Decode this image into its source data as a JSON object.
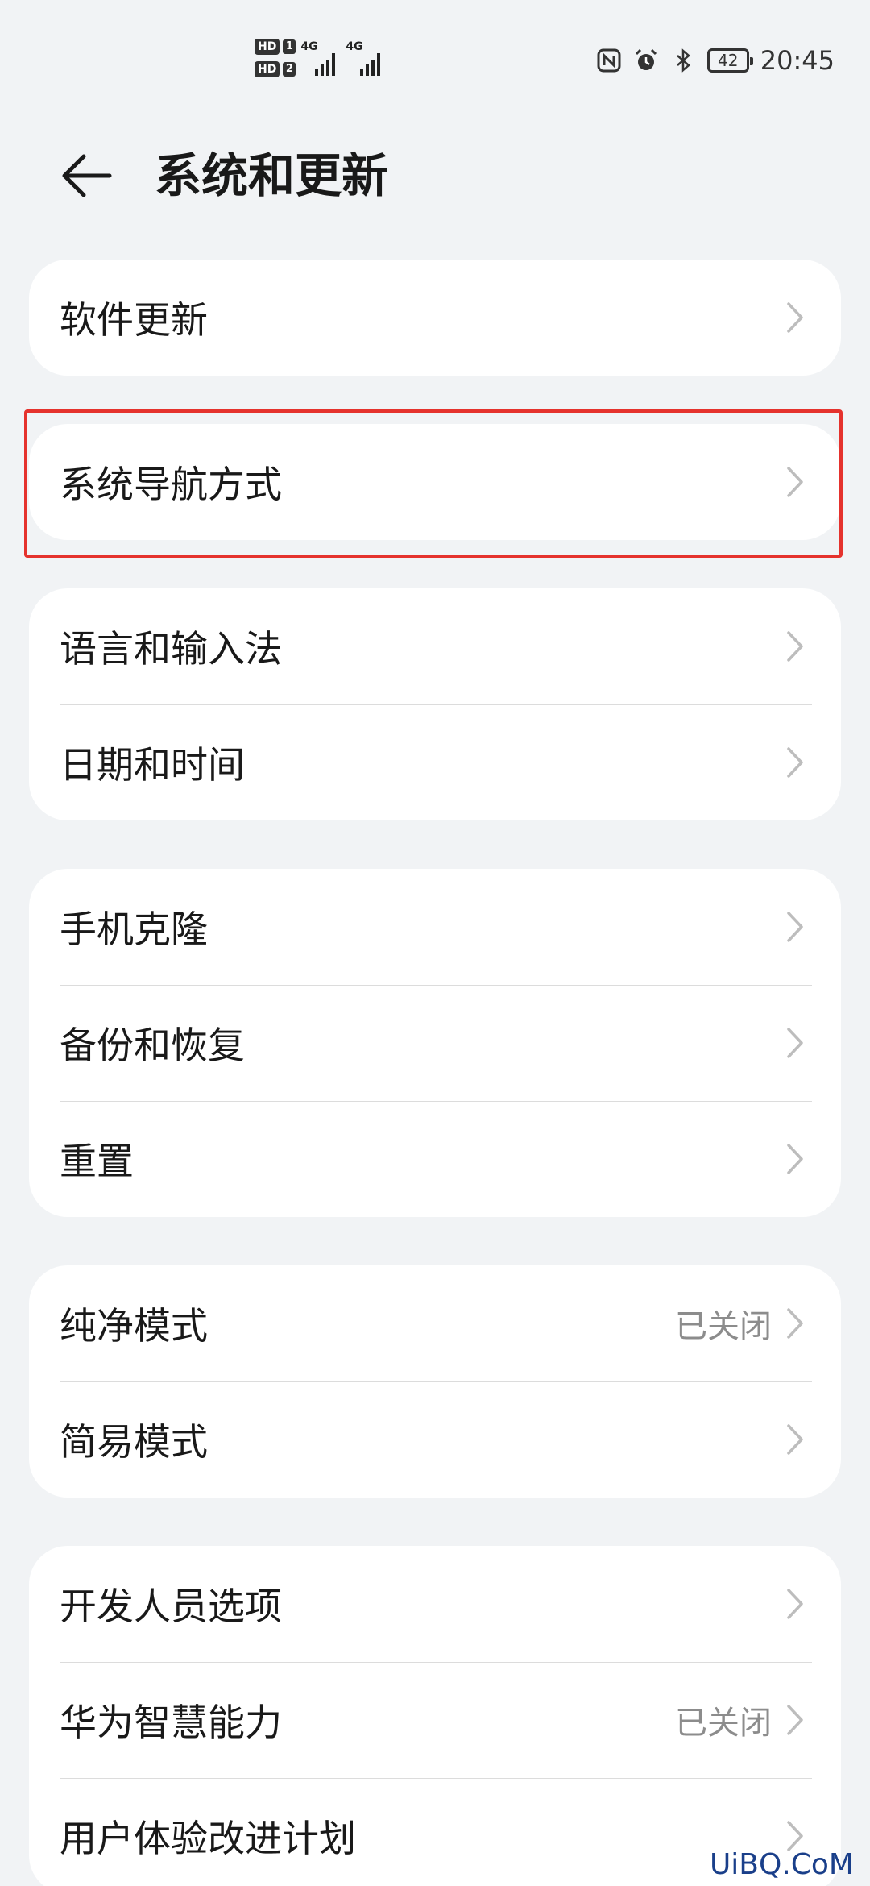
{
  "status_bar": {
    "sim1_badge": "HD",
    "sim1_num": "1",
    "sim2_badge": "HD",
    "sim2_num": "2",
    "network1": "4G",
    "network2": "4G",
    "battery": "42",
    "time": "20:45",
    "icons": [
      "nfc-icon",
      "alarm-icon",
      "bluetooth-icon",
      "battery-icon"
    ]
  },
  "header": {
    "title": "系统和更新",
    "back_icon": "back-arrow-icon"
  },
  "groups": [
    {
      "items": [
        {
          "label": "软件更新",
          "value": ""
        }
      ]
    },
    {
      "items": [
        {
          "label": "系统导航方式",
          "value": ""
        }
      ]
    },
    {
      "items": [
        {
          "label": "语言和输入法",
          "value": ""
        },
        {
          "label": "日期和时间",
          "value": ""
        }
      ]
    },
    {
      "items": [
        {
          "label": "手机克隆",
          "value": ""
        },
        {
          "label": "备份和恢复",
          "value": ""
        },
        {
          "label": "重置",
          "value": ""
        }
      ]
    },
    {
      "items": [
        {
          "label": "纯净模式",
          "value": "已关闭"
        },
        {
          "label": "简易模式",
          "value": ""
        }
      ]
    },
    {
      "items": [
        {
          "label": "开发人员选项",
          "value": ""
        },
        {
          "label": "华为智慧能力",
          "value": "已关闭"
        },
        {
          "label": "用户体验改进计划",
          "value": ""
        }
      ]
    }
  ],
  "highlight_color": "#e5322d",
  "watermark": "UiBQ.CoM"
}
